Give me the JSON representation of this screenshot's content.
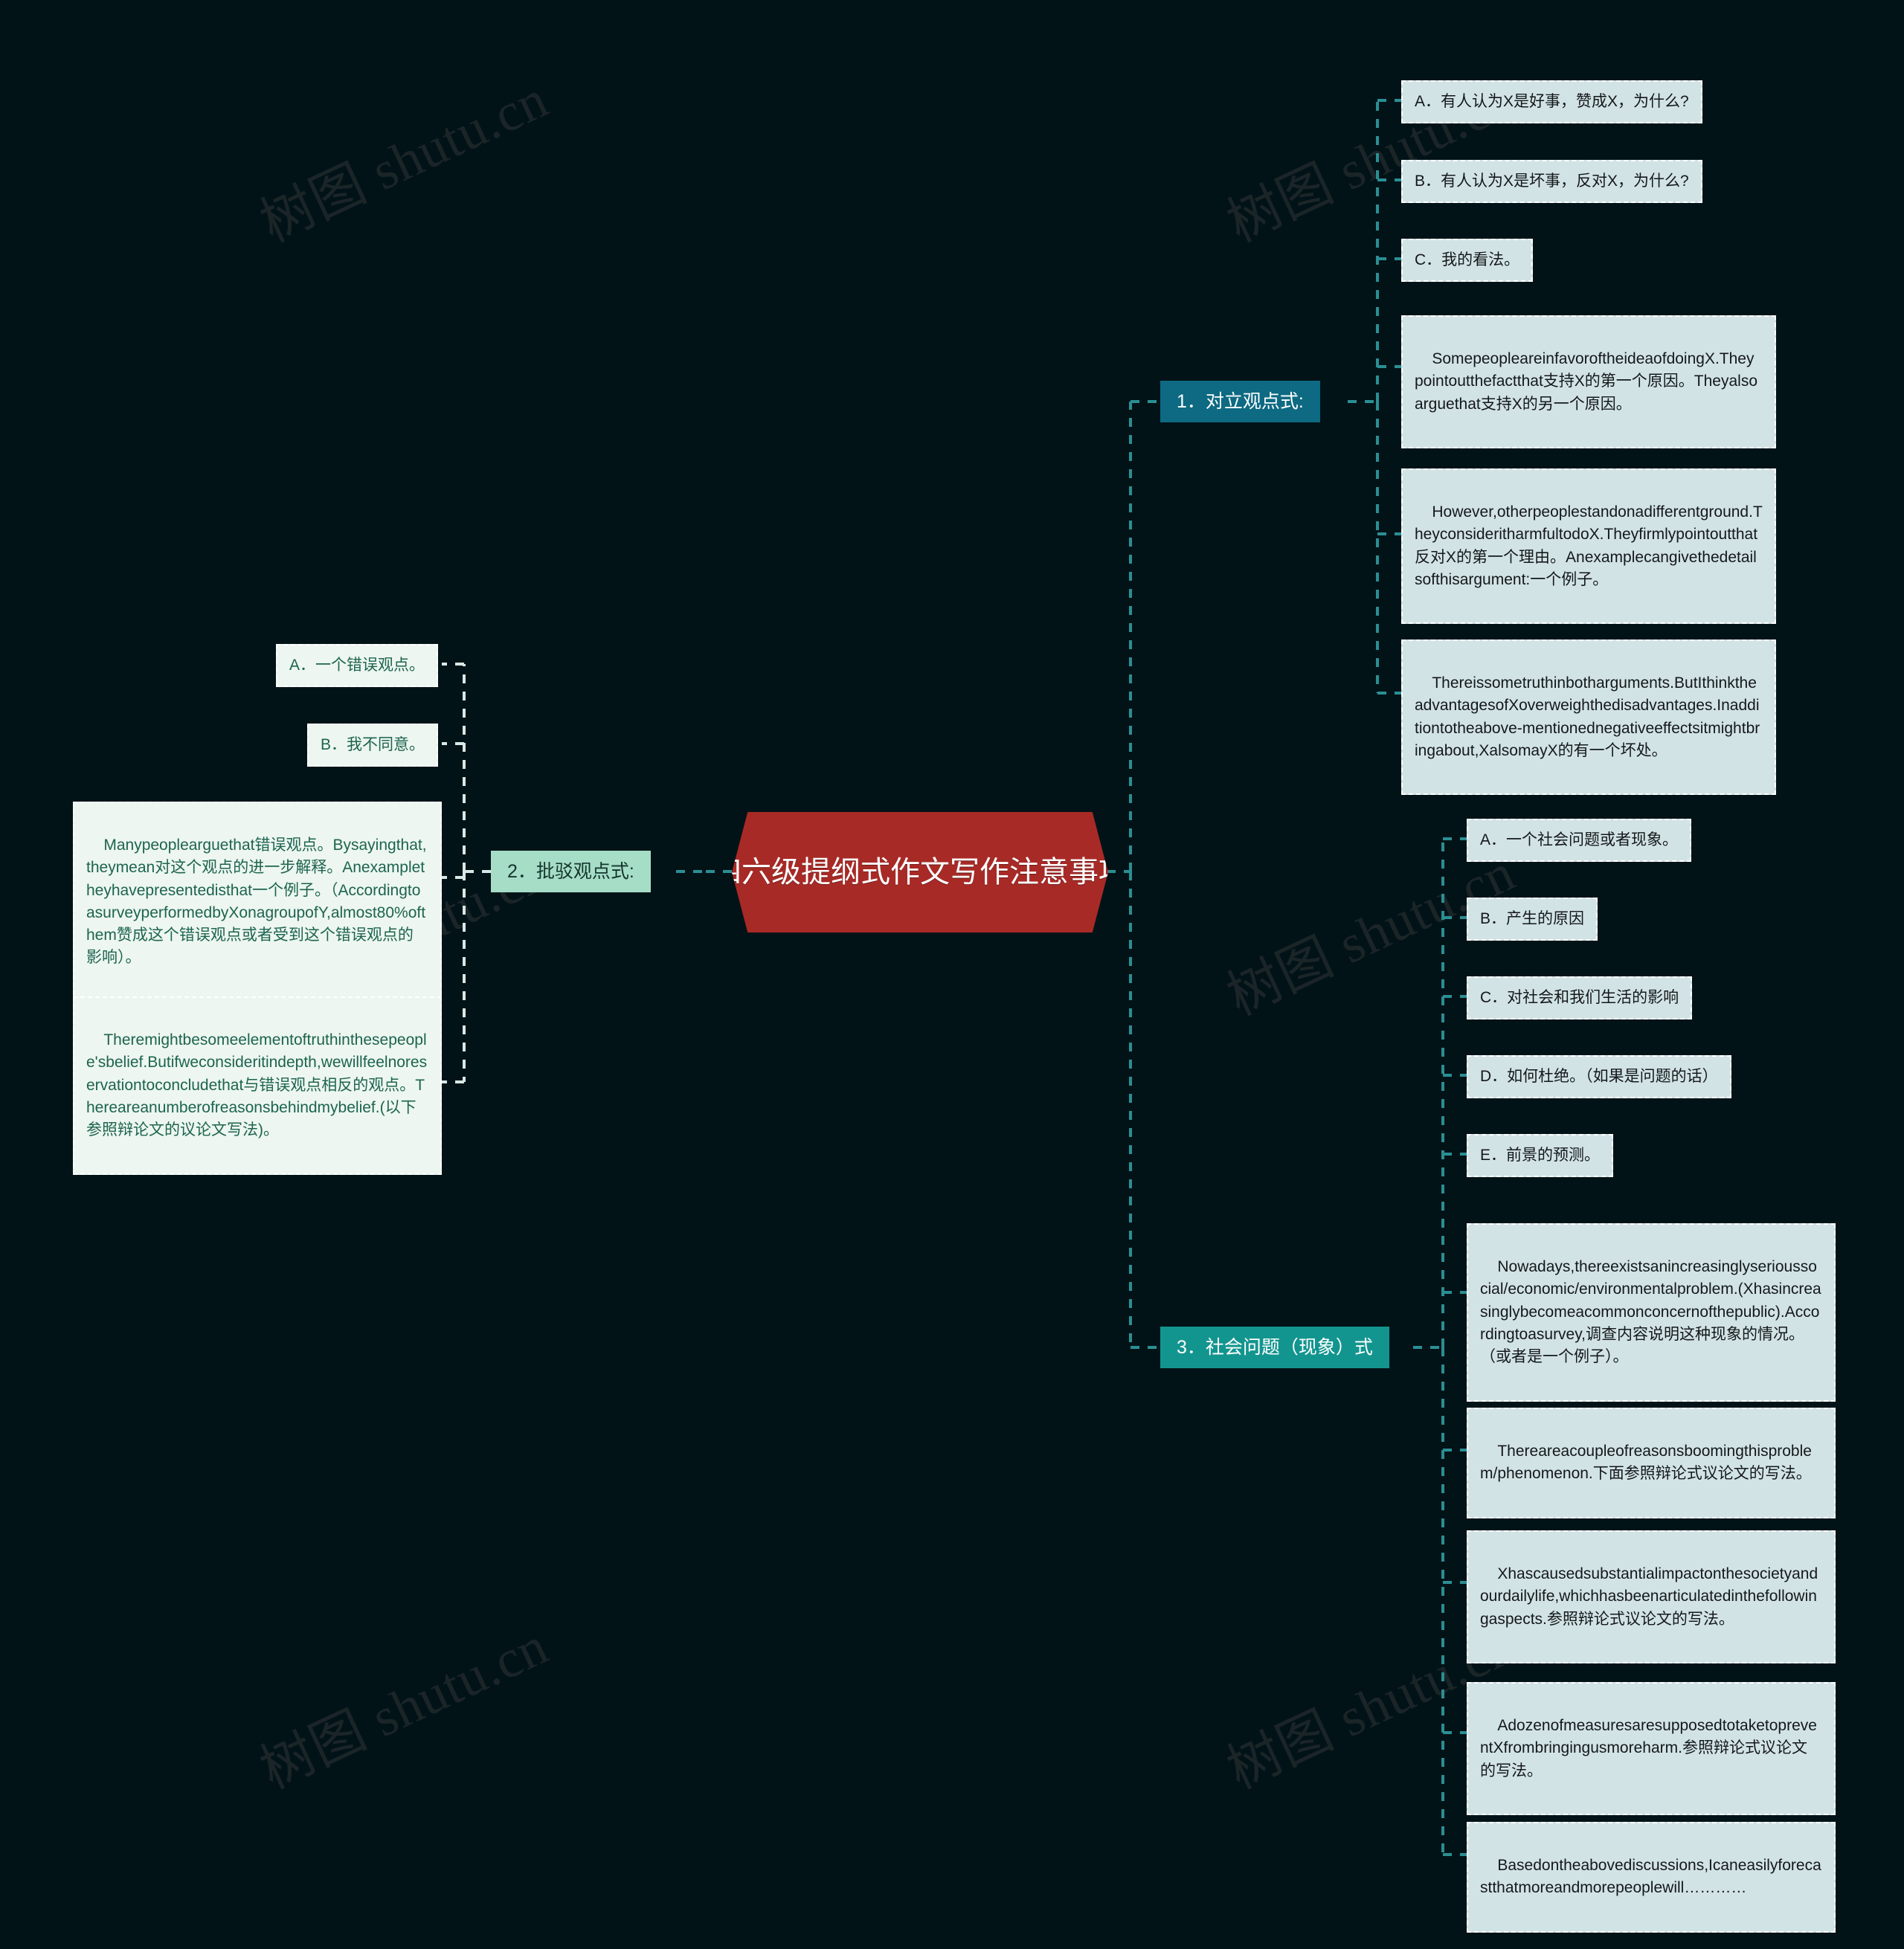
{
  "meta": {
    "title": "四六级提纲式作文写作注意事项",
    "watermark_text": "树图 shutu.cn",
    "background_color": "#021318",
    "root_color": "#a82a26",
    "branch1_color": "#0d6a82",
    "branch2_color": "#a6ddc6",
    "branch3_color": "#13958f",
    "leaf_blue_color": "#d2e3e6",
    "leaf_green_color": "#edf6f0",
    "connector_color": "#2a8f93"
  },
  "root": {
    "label": "四六级提纲式作文写作注意事项"
  },
  "branches": [
    {
      "id": "b1",
      "label": "1．对立观点式:",
      "side": "right",
      "leaves": [
        {
          "id": "b1-a",
          "text": "A．有人认为X是好事，赞成X，为什么?"
        },
        {
          "id": "b1-b",
          "text": "B．有人认为X是坏事，反对X，为什么?"
        },
        {
          "id": "b1-c",
          "text": "C．我的看法。"
        },
        {
          "id": "b1-d",
          "text": "SomepeopleareinfavoroftheideaofdoingX.Theypointoutthefactthat支持X的第一个原因。Theyalsoarguethat支持X的另一个原因。"
        },
        {
          "id": "b1-e",
          "text": "However,otherpeoplestandonadifferentground.TheyconsideritharmfultodoX.Theyfirmlypointoutthat反对X的第一个理由。Anexamplecangivethedetailsofthisargument:一个例子。"
        },
        {
          "id": "b1-f",
          "text": "Thereissometruthinbotharguments.ButIthinktheadvantagesofXoverweighthedisadvantages.Inadditiontotheabove-mentionednegativeeffectsitmightbringabout,XalsomayX的有一个坏处。"
        }
      ]
    },
    {
      "id": "b2",
      "label": "2．批驳观点式:",
      "side": "left",
      "leaves": [
        {
          "id": "b2-a",
          "text": "A．一个错误观点。"
        },
        {
          "id": "b2-b",
          "text": "B．我不同意。"
        },
        {
          "id": "b2-c",
          "text": "Manypeoplearguethat错误观点。Bysayingthat,theymean对这个观点的进一步解释。Anexampletheyhavepresentedisthat一个例子。（AccordingtoasurveyperformedbyXonagroupofY,almost80%ofthem赞成这个错误观点或者受到这个错误观点的影响）。"
        },
        {
          "id": "b2-d",
          "text": "Theremightbesomeelementoftruthinthesepeople'sbelief.Butifweconsideritindepth,wewillfeelnoreservationtoconcludethat与错误观点相反的观点。Thereareanumberofreasonsbehindmybelief.(以下参照辩论文的议论文写法)。"
        }
      ]
    },
    {
      "id": "b3",
      "label": "3．社会问题（现象）式",
      "side": "right",
      "leaves": [
        {
          "id": "b3-a",
          "text": "A．一个社会问题或者现象。"
        },
        {
          "id": "b3-b",
          "text": "B．产生的原因"
        },
        {
          "id": "b3-c",
          "text": "C．对社会和我们生活的影响"
        },
        {
          "id": "b3-d",
          "text": "D．如何杜绝。（如果是问题的话）"
        },
        {
          "id": "b3-e",
          "text": "E．前景的预测。"
        },
        {
          "id": "b3-f",
          "text": "Nowadays,thereexistsanincreasinglyserioussocial/economic/environmentalproblem.(Xhasincreasinglybecomeacommonconcernofthepublic).Accordingtoasurvey,调查内容说明这种现象的情况。（或者是一个例子）。"
        },
        {
          "id": "b3-g",
          "text": "Thereareacoupleofreasonsboomingthisproblem/phenomenon.下面参照辩论式议论文的写法。"
        },
        {
          "id": "b3-h",
          "text": "Xhascausedsubstantialimpactonthesocietyandourdailylife,whichhasbeenarticulatedinthefollowingaspects.参照辩论式议论文的写法。"
        },
        {
          "id": "b3-i",
          "text": "AdozenofmeasuresaresupposedtotaketopreventXfrombringingusmoreharm.参照辩论式议论文的写法。"
        },
        {
          "id": "b3-j",
          "text": "Basedontheabovediscussions,Icaneasilyforecastthatmoreandmorepeoplewill…………"
        }
      ]
    }
  ]
}
